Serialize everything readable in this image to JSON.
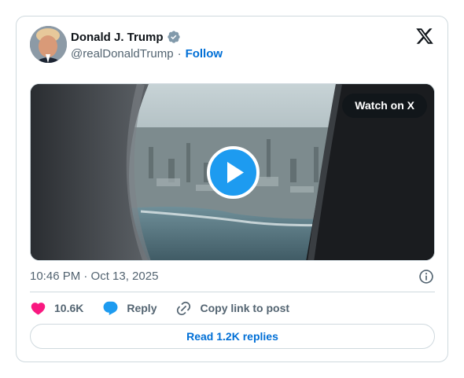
{
  "author": {
    "display_name": "Donald J. Trump",
    "handle": "@realDonaldTrump",
    "separator": "·",
    "follow_label": "Follow",
    "avatar_icon": "profile-photo",
    "verified_icon": "verified-badge-icon"
  },
  "platform": {
    "logo_icon": "x-logo-icon"
  },
  "media": {
    "watch_label": "Watch on X",
    "play_icon": "play-icon",
    "description": "airplane window view of coastal city"
  },
  "timestamp": "10:46 PM · Oct 13, 2025",
  "info_icon": "info-icon",
  "actions": {
    "like_count": "10.6K",
    "reply_label": "Reply",
    "copy_label": "Copy link to post"
  },
  "read_replies_label": "Read 1.2K replies",
  "colors": {
    "link_blue": "#006fd6",
    "play_blue": "#1d9bf0",
    "like_pink": "#f91880",
    "muted_gray": "#536471",
    "border": "#cfd9de"
  }
}
